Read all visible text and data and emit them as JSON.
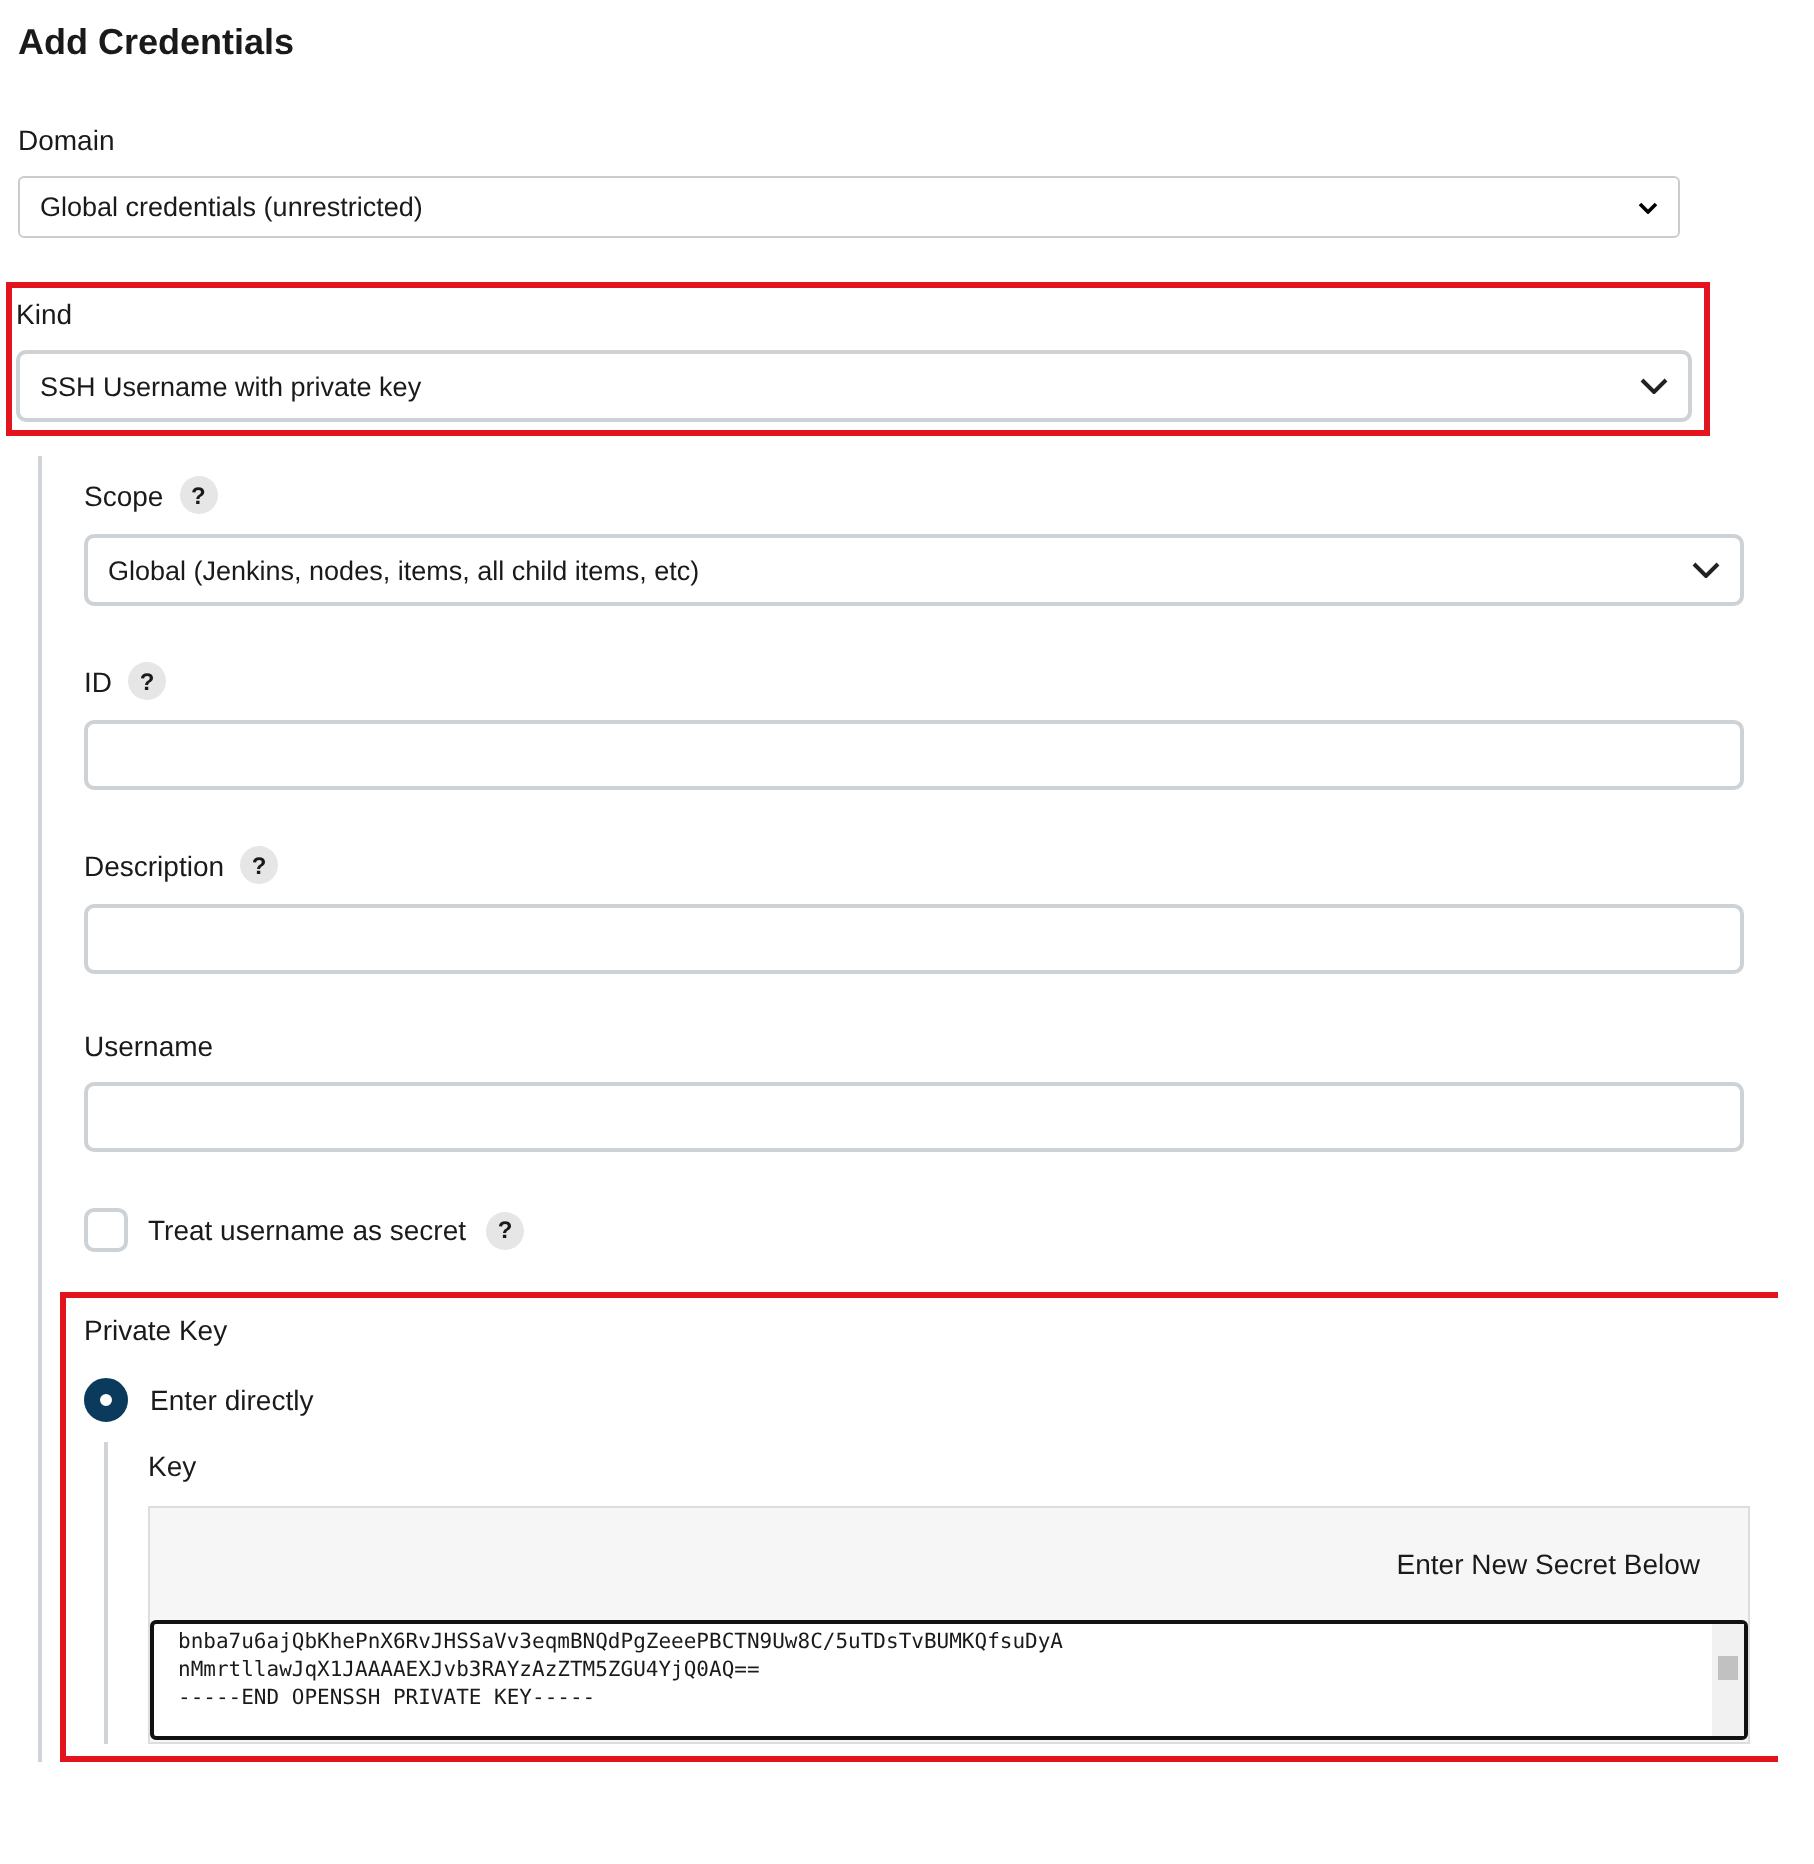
{
  "title": "Add Credentials",
  "domain": {
    "label": "Domain",
    "value": "Global credentials (unrestricted)"
  },
  "kind": {
    "label": "Kind",
    "value": "SSH Username with private key",
    "highlighted": true
  },
  "fields": [
    {
      "kind": "select",
      "label": "Scope",
      "help": "?",
      "value": "Global (Jenkins, nodes, items, all child items, etc)"
    },
    {
      "kind": "text",
      "label": "ID",
      "help": "?"
    },
    {
      "kind": "text",
      "label": "Description",
      "help": "?"
    },
    {
      "kind": "text",
      "label": "Username"
    },
    {
      "kind": "checkbox",
      "label": "Treat username as secret",
      "help": "?",
      "checked": false
    }
  ],
  "private_key": {
    "label": "Private Key",
    "highlighted": true,
    "options": [
      {
        "label": "Enter directly",
        "selected": true
      }
    ],
    "key_label": "Key",
    "secret_note": "Enter New Secret Below",
    "key_lines": [
      "bnba7u6ajQbKhePnX6RvJHSSaVv3eqmBNQdPgZeeePBCTN9Uw8C/5uTDsTvBUMKQfsuDyA",
      "nMmrtllawJqX1JAAAAEXJvb3RAYzAzZTM5ZGU4YjQ0AQ==",
      "-----END OPENSSH PRIVATE KEY-----"
    ]
  }
}
